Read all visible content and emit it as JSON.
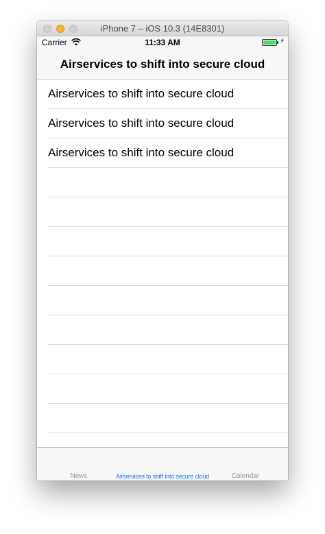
{
  "window": {
    "title": "iPhone 7 – iOS 10.3 (14E8301)"
  },
  "status_bar": {
    "carrier": "Carrier",
    "time": "11:33 AM",
    "battery_level": 1.0,
    "battery_color": "#4cd964",
    "icons": [
      "wifi-icon",
      "battery-icon",
      "charging-bolt-icon"
    ]
  },
  "nav_bar": {
    "title": "Airservices to shift into secure cloud"
  },
  "table": {
    "rows": [
      "Airservices to shift into secure cloud",
      "Airservices to shift into secure cloud",
      "Airservices to shift into secure cloud",
      "",
      "",
      "",
      "",
      "",
      "",
      "",
      "",
      "",
      ""
    ]
  },
  "tab_bar": {
    "tabs": [
      {
        "label": "News",
        "selected": false
      },
      {
        "label": "Airservices to shift into secure cloud",
        "selected": true
      },
      {
        "label": "Calendar",
        "selected": false
      }
    ],
    "accent_color": "#0a7aff",
    "inactive_color": "#929292"
  }
}
